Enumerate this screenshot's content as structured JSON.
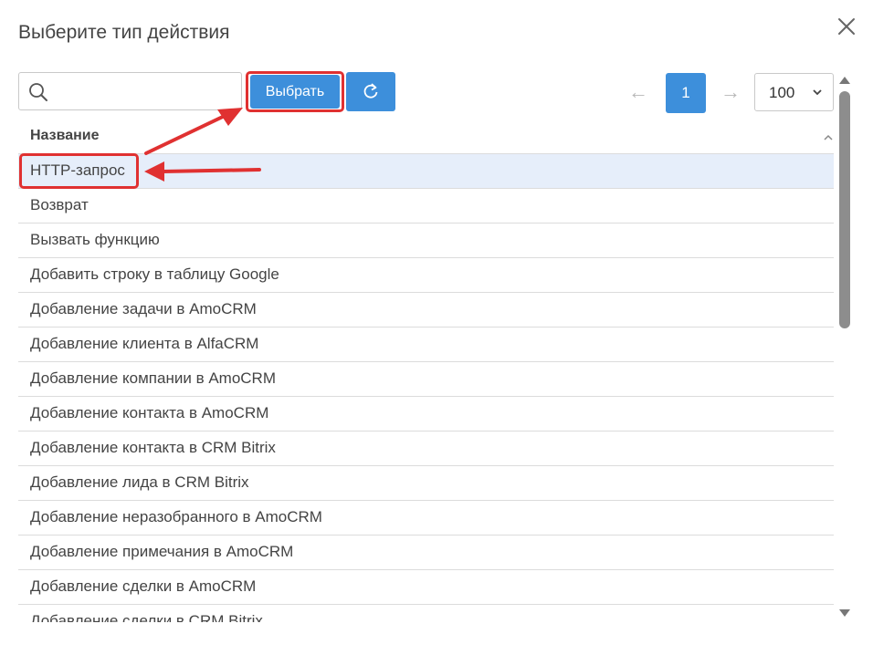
{
  "dialog": {
    "title": "Выберите тип действия",
    "close_icon": "close-icon"
  },
  "toolbar": {
    "search_value": "",
    "search_icon": "search-icon",
    "select_label": "Выбрать",
    "refresh_icon": "refresh-icon"
  },
  "pagination": {
    "prev_label": "←",
    "current_page": "1",
    "next_label": "→",
    "per_page": "100"
  },
  "table": {
    "column_header": "Название",
    "rows": [
      "HTTP-запрос",
      "Возврат",
      "Вызвать функцию",
      "Добавить строку в таблицу Google",
      "Добавление задачи в AmoCRM",
      "Добавление клиента в AlfaCRM",
      "Добавление компании в AmoCRM",
      "Добавление контакта в AmoCRM",
      "Добавление контакта в CRM Bitrix",
      "Добавление лида в CRM Bitrix",
      "Добавление неразобранного в AmoCRM",
      "Добавление примечания в AmoCRM",
      "Добавление сделки в AmoCRM",
      "Добавление сделки в CRM Bitrix"
    ],
    "selected_index": 0
  },
  "colors": {
    "accent": "#3d8fdb",
    "annotation": "#e03131",
    "selected_row": "#e6eefa"
  }
}
